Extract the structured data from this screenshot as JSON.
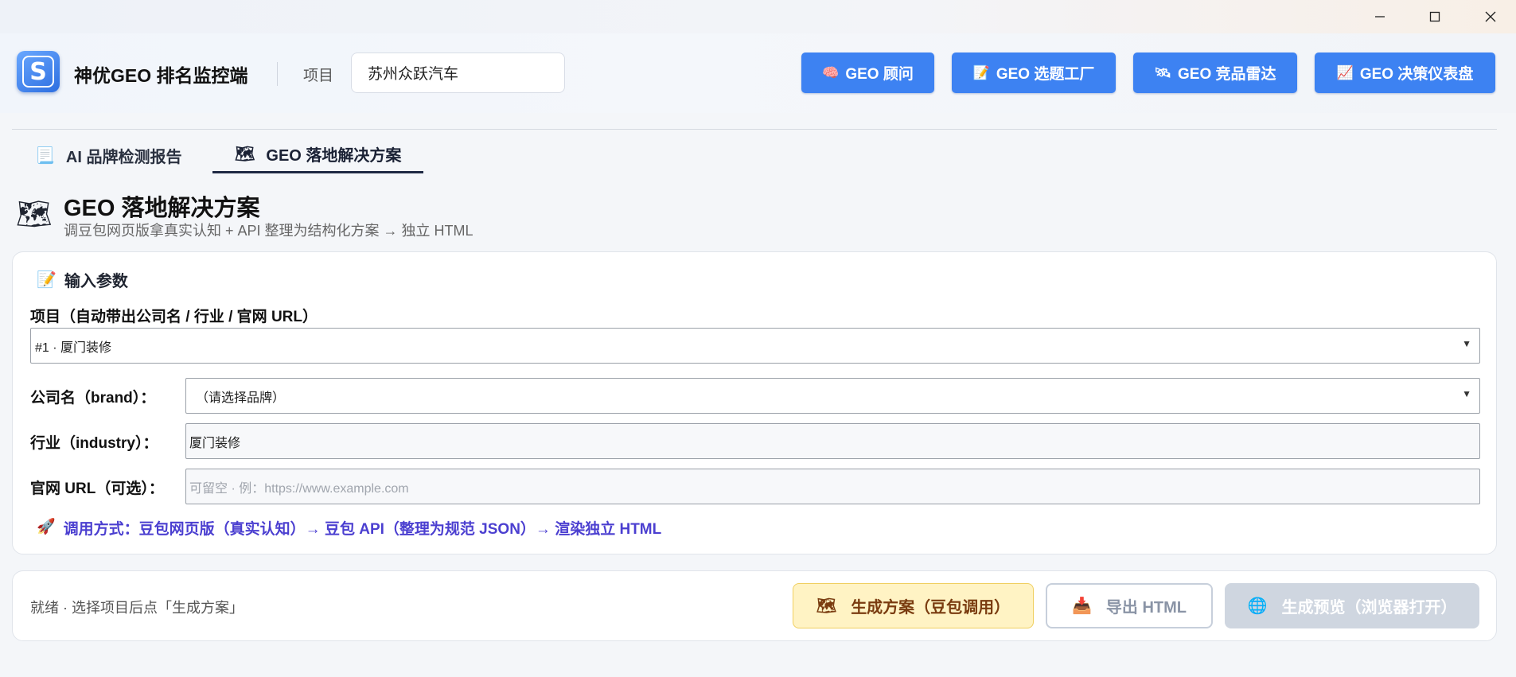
{
  "window": {
    "minimize_icon": "minimize-icon",
    "maximize_icon": "maximize-icon",
    "close_icon": "close-icon"
  },
  "header": {
    "logo_letter": "S",
    "app_title": "神优GEO 排名监控端",
    "project_label": "项目",
    "project_value": "苏州众跃汽车",
    "buttons": [
      {
        "icon": "🧠",
        "label": "GEO 顾问"
      },
      {
        "icon": "📝",
        "label": "GEO 选题工厂"
      },
      {
        "icon": "🛰",
        "label": "GEO 竞品雷达"
      },
      {
        "icon": "📈",
        "label": "GEO 决策仪表盘"
      }
    ]
  },
  "tabs": [
    {
      "icon": "📃",
      "label": "AI 品牌检测报告",
      "active": false
    },
    {
      "icon": "🗺",
      "label": "GEO 落地解决方案",
      "active": true
    }
  ],
  "section": {
    "icon": "🗺",
    "title": "GEO 落地解决方案",
    "subtitle": "调豆包网页版拿真实认知 + API 整理为结构化方案 → 独立 HTML"
  },
  "input_card": {
    "icon": "📝",
    "title": "输入参数",
    "project_field_label": "项目（自动带出公司名 / 行业 / 官网 URL）",
    "project_selected": "#1 · 厦门装修",
    "brand_label": "公司名（brand）：",
    "brand_selected": "（请选择品牌）",
    "industry_label": "行业（industry）：",
    "industry_value": "厦门装修",
    "url_label": "官网 URL（可选）：",
    "url_placeholder": "可留空 · 例：https://www.example.com",
    "hint_icon": "🚀",
    "hint_text": "调用方式：豆包网页版（真实认知）→ 豆包 API（整理为规范 JSON）→ 渲染独立 HTML"
  },
  "action_bar": {
    "status_text": "就绪 · 选择项目后点「生成方案」",
    "generate": {
      "icon": "🗺",
      "label": "生成方案（豆包调用）"
    },
    "export": {
      "icon": "📥",
      "label": "导出 HTML"
    },
    "preview": {
      "icon": "🌐",
      "label": "生成预览（浏览器打开）"
    }
  },
  "colors": {
    "primary_button": "#3d82f2",
    "hint_text": "#4b3fd0",
    "generate_bg": "#fff3c4",
    "disabled_bg": "#cfd6e0"
  }
}
